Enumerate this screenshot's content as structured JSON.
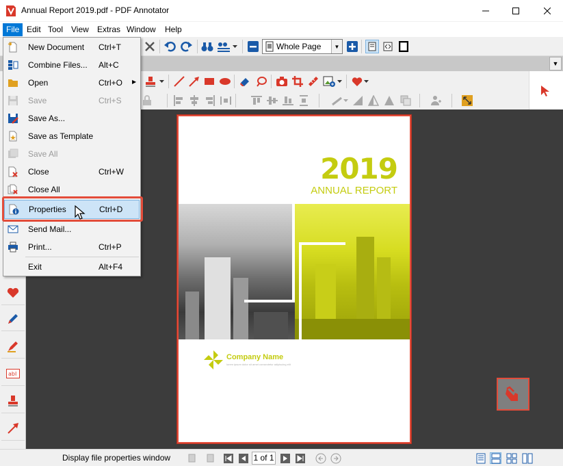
{
  "window": {
    "title": "Annual Report 2019.pdf - PDF Annotator",
    "minimize": "—",
    "maximize": "☐",
    "close": "✕"
  },
  "menubar": {
    "items": [
      {
        "label": "File",
        "active": true
      },
      {
        "label": "Edit"
      },
      {
        "label": "Tool"
      },
      {
        "label": "View"
      },
      {
        "label": "Extras"
      },
      {
        "label": "Window"
      },
      {
        "label": "Help"
      }
    ]
  },
  "toolbar": {
    "zoom_value": "Whole Page"
  },
  "file_menu": {
    "items": [
      {
        "label": "New Document",
        "shortcut": "Ctrl+T",
        "icon": "new-document-icon",
        "enabled": true
      },
      {
        "label": "Combine Files...",
        "shortcut": "Alt+C",
        "icon": "combine-files-icon",
        "enabled": true
      },
      {
        "label": "Open",
        "shortcut": "Ctrl+O",
        "icon": "open-folder-icon",
        "enabled": true,
        "submenu": true
      },
      {
        "label": "Save",
        "shortcut": "Ctrl+S",
        "icon": "save-icon",
        "enabled": false
      },
      {
        "label": "Save As...",
        "shortcut": "",
        "icon": "save-as-icon",
        "enabled": true
      },
      {
        "label": "Save as Template",
        "shortcut": "",
        "icon": "save-template-icon",
        "enabled": true
      },
      {
        "label": "Save All",
        "shortcut": "",
        "icon": "save-all-icon",
        "enabled": false
      },
      {
        "label": "Close",
        "shortcut": "Ctrl+W",
        "icon": "close-doc-icon",
        "enabled": true
      },
      {
        "label": "Close All",
        "shortcut": "",
        "icon": "close-all-icon",
        "enabled": true
      },
      {
        "label": "Properties",
        "shortcut": "Ctrl+D",
        "icon": "properties-icon",
        "enabled": true,
        "highlighted": true
      },
      {
        "label": "Send Mail...",
        "shortcut": "",
        "icon": "send-mail-icon",
        "enabled": true
      },
      {
        "label": "Print...",
        "shortcut": "Ctrl+P",
        "icon": "print-icon",
        "enabled": true
      },
      {
        "label": "Exit",
        "shortcut": "Alt+F4",
        "icon": "",
        "enabled": true
      }
    ]
  },
  "document": {
    "year": "2019",
    "subtitle": "ANNUAL REPORT",
    "company": "Company Name",
    "tagline": "lorem ipsum dolor sit amet consectetur adipiscing elit"
  },
  "statusbar": {
    "text": "Display file properties window",
    "page_indicator": "1 of 1"
  },
  "colors": {
    "accent": "#e34c3a",
    "brand_yellow": "#c4cc10",
    "menu_active": "#0078d7"
  }
}
